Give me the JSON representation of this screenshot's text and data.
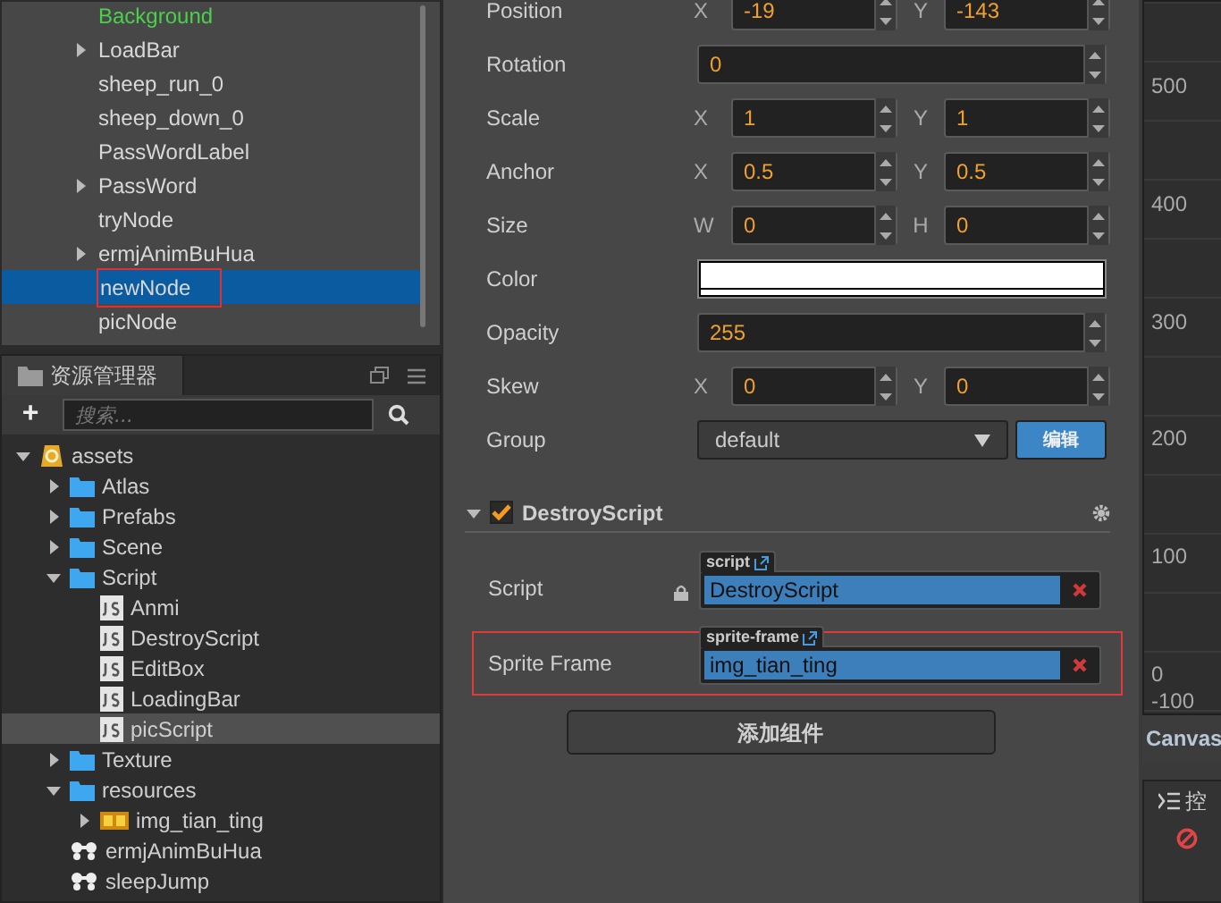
{
  "hierarchy": {
    "items": [
      {
        "label": "Background",
        "kind": "prefab",
        "expandable": false,
        "selected": false,
        "outlined": false
      },
      {
        "label": "LoadBar",
        "kind": "node",
        "expandable": true,
        "selected": false,
        "outlined": false
      },
      {
        "label": "sheep_run_0",
        "kind": "node",
        "expandable": false,
        "selected": false,
        "outlined": false
      },
      {
        "label": "sheep_down_0",
        "kind": "node",
        "expandable": false,
        "selected": false,
        "outlined": false
      },
      {
        "label": "PassWordLabel",
        "kind": "node",
        "expandable": false,
        "selected": false,
        "outlined": false
      },
      {
        "label": "PassWord",
        "kind": "node",
        "expandable": true,
        "selected": false,
        "outlined": false
      },
      {
        "label": "tryNode",
        "kind": "node",
        "expandable": false,
        "selected": false,
        "outlined": false
      },
      {
        "label": "ermjAnimBuHua",
        "kind": "node",
        "expandable": true,
        "selected": false,
        "outlined": false
      },
      {
        "label": "newNode",
        "kind": "node",
        "expandable": false,
        "selected": true,
        "outlined": true
      },
      {
        "label": "picNode",
        "kind": "node",
        "expandable": false,
        "selected": false,
        "outlined": false
      }
    ]
  },
  "assets": {
    "title": "资源管理器",
    "add": "+",
    "search": {
      "placeholder": "搜索..."
    },
    "tree": [
      {
        "label": "assets",
        "kind": "db",
        "expanded": true,
        "selected": false,
        "children": [
          {
            "label": "Atlas",
            "kind": "folder",
            "expanded": false,
            "selected": false
          },
          {
            "label": "Prefabs",
            "kind": "folder",
            "expanded": false,
            "selected": false
          },
          {
            "label": "Scene",
            "kind": "folder",
            "expanded": false,
            "selected": false
          },
          {
            "label": "Script",
            "kind": "folder",
            "expanded": true,
            "selected": false,
            "children": [
              {
                "label": "Anmi",
                "kind": "script",
                "selected": false
              },
              {
                "label": "DestroyScript",
                "kind": "script",
                "selected": false
              },
              {
                "label": "EditBox",
                "kind": "script",
                "selected": false
              },
              {
                "label": "LoadingBar",
                "kind": "script",
                "selected": false
              },
              {
                "label": "picScript",
                "kind": "script",
                "selected": true
              }
            ]
          },
          {
            "label": "Texture",
            "kind": "folder",
            "expanded": false,
            "selected": false
          },
          {
            "label": "resources",
            "kind": "folder",
            "expanded": true,
            "selected": false,
            "children": [
              {
                "label": "img_tian_ting",
                "kind": "image",
                "expanded": false,
                "selected": false
              }
            ]
          },
          {
            "label": "ermjAnimBuHua",
            "kind": "anim",
            "selected": false
          },
          {
            "label": "sleepJump",
            "kind": "anim",
            "selected": false
          }
        ]
      }
    ]
  },
  "inspector": {
    "properties": [
      {
        "label": "Position",
        "kind": "vec2",
        "a": "X",
        "av": "-19",
        "b": "Y",
        "bv": "-143"
      },
      {
        "label": "Rotation",
        "kind": "number",
        "value": "0"
      },
      {
        "label": "Scale",
        "kind": "vec2",
        "a": "X",
        "av": "1",
        "b": "Y",
        "bv": "1"
      },
      {
        "label": "Anchor",
        "kind": "vec2",
        "a": "X",
        "av": "0.5",
        "b": "Y",
        "bv": "0.5"
      },
      {
        "label": "Size",
        "kind": "vec2",
        "a": "W",
        "av": "0",
        "b": "H",
        "bv": "0"
      },
      {
        "label": "Color",
        "kind": "color",
        "color": "#ffffff"
      },
      {
        "label": "Opacity",
        "kind": "number",
        "value": "255"
      },
      {
        "label": "Skew",
        "kind": "vec2",
        "a": "X",
        "av": "0",
        "b": "Y",
        "bv": "0"
      },
      {
        "label": "Group",
        "kind": "group",
        "value": "default",
        "button": "编辑"
      }
    ],
    "component": {
      "title": "DestroyScript",
      "enabled": true,
      "expanded": true,
      "fields": [
        {
          "label": "Script",
          "tag": "script",
          "value": "DestroyScript",
          "locked": true,
          "highlighted": false
        },
        {
          "label": "Sprite Frame",
          "tag": "sprite-frame",
          "value": "img_tian_ting",
          "locked": false,
          "highlighted": true
        }
      ]
    },
    "add_button": "添加组件"
  },
  "scene": {
    "ruler": [
      "500",
      "400",
      "300",
      "200",
      "100",
      "0",
      "-100"
    ],
    "tab": "Canvas"
  },
  "console": {
    "title": "控"
  }
}
